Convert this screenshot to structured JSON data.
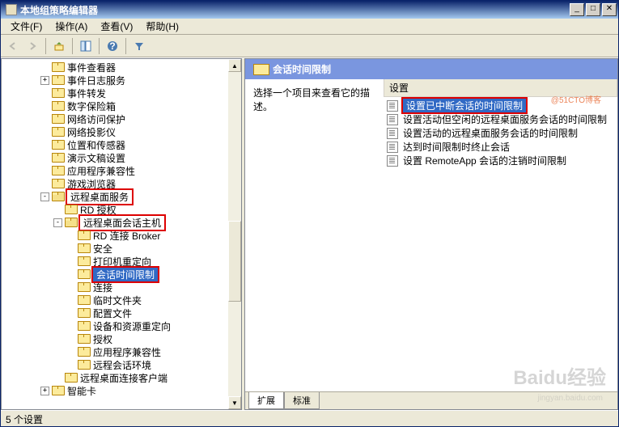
{
  "window": {
    "title": "本地组策略编辑器"
  },
  "menu": {
    "file": "文件(F)",
    "action": "操作(A)",
    "view": "查看(V)",
    "help": "帮助(H)"
  },
  "tree": {
    "items": [
      {
        "indent": 3,
        "exp": "",
        "label": "事件查看器"
      },
      {
        "indent": 3,
        "exp": "+",
        "label": "事件日志服务"
      },
      {
        "indent": 3,
        "exp": "",
        "label": "事件转发"
      },
      {
        "indent": 3,
        "exp": "",
        "label": "数字保险箱"
      },
      {
        "indent": 3,
        "exp": "",
        "label": "网络访问保护"
      },
      {
        "indent": 3,
        "exp": "",
        "label": "网络投影仪"
      },
      {
        "indent": 3,
        "exp": "",
        "label": "位置和传感器"
      },
      {
        "indent": 3,
        "exp": "",
        "label": "演示文稿设置"
      },
      {
        "indent": 3,
        "exp": "",
        "label": "应用程序兼容性"
      },
      {
        "indent": 3,
        "exp": "",
        "label": "游戏浏览器"
      },
      {
        "indent": 3,
        "exp": "-",
        "label": "远程桌面服务",
        "hl": true,
        "open": true
      },
      {
        "indent": 4,
        "exp": "",
        "label": "RD 授权"
      },
      {
        "indent": 4,
        "exp": "-",
        "label": "远程桌面会话主机",
        "hl": true,
        "open": true
      },
      {
        "indent": 5,
        "exp": "",
        "label": "RD 连接 Broker"
      },
      {
        "indent": 5,
        "exp": "",
        "label": "安全"
      },
      {
        "indent": 5,
        "exp": "",
        "label": "打印机重定向"
      },
      {
        "indent": 5,
        "exp": "",
        "label": "会话时间限制",
        "hl": true,
        "sel": true
      },
      {
        "indent": 5,
        "exp": "",
        "label": "连接"
      },
      {
        "indent": 5,
        "exp": "",
        "label": "临时文件夹"
      },
      {
        "indent": 5,
        "exp": "",
        "label": "配置文件"
      },
      {
        "indent": 5,
        "exp": "",
        "label": "设备和资源重定向"
      },
      {
        "indent": 5,
        "exp": "",
        "label": "授权"
      },
      {
        "indent": 5,
        "exp": "",
        "label": "应用程序兼容性"
      },
      {
        "indent": 5,
        "exp": "",
        "label": "远程会话环境"
      },
      {
        "indent": 4,
        "exp": "",
        "label": "远程桌面连接客户端"
      },
      {
        "indent": 3,
        "exp": "+",
        "label": "智能卡"
      }
    ]
  },
  "detail": {
    "header": "会话时间限制",
    "description": "选择一个项目来查看它的描述。",
    "settings_header": "设置",
    "items": [
      {
        "label": "设置已中断会话的时间限制",
        "hl": true
      },
      {
        "label": "设置活动但空闲的远程桌面服务会话的时间限制"
      },
      {
        "label": "设置活动的远程桌面服务会话的时间限制"
      },
      {
        "label": "达到时间限制时终止会话"
      },
      {
        "label": "设置 RemoteApp 会话的注销时间限制"
      }
    ]
  },
  "tabs": {
    "extended": "扩展",
    "standard": "标准"
  },
  "status": "5 个设置",
  "watermark": {
    "main": "Baidu经验",
    "sub": "jingyan.baidu.com"
  },
  "corner": "@51CTO博客"
}
